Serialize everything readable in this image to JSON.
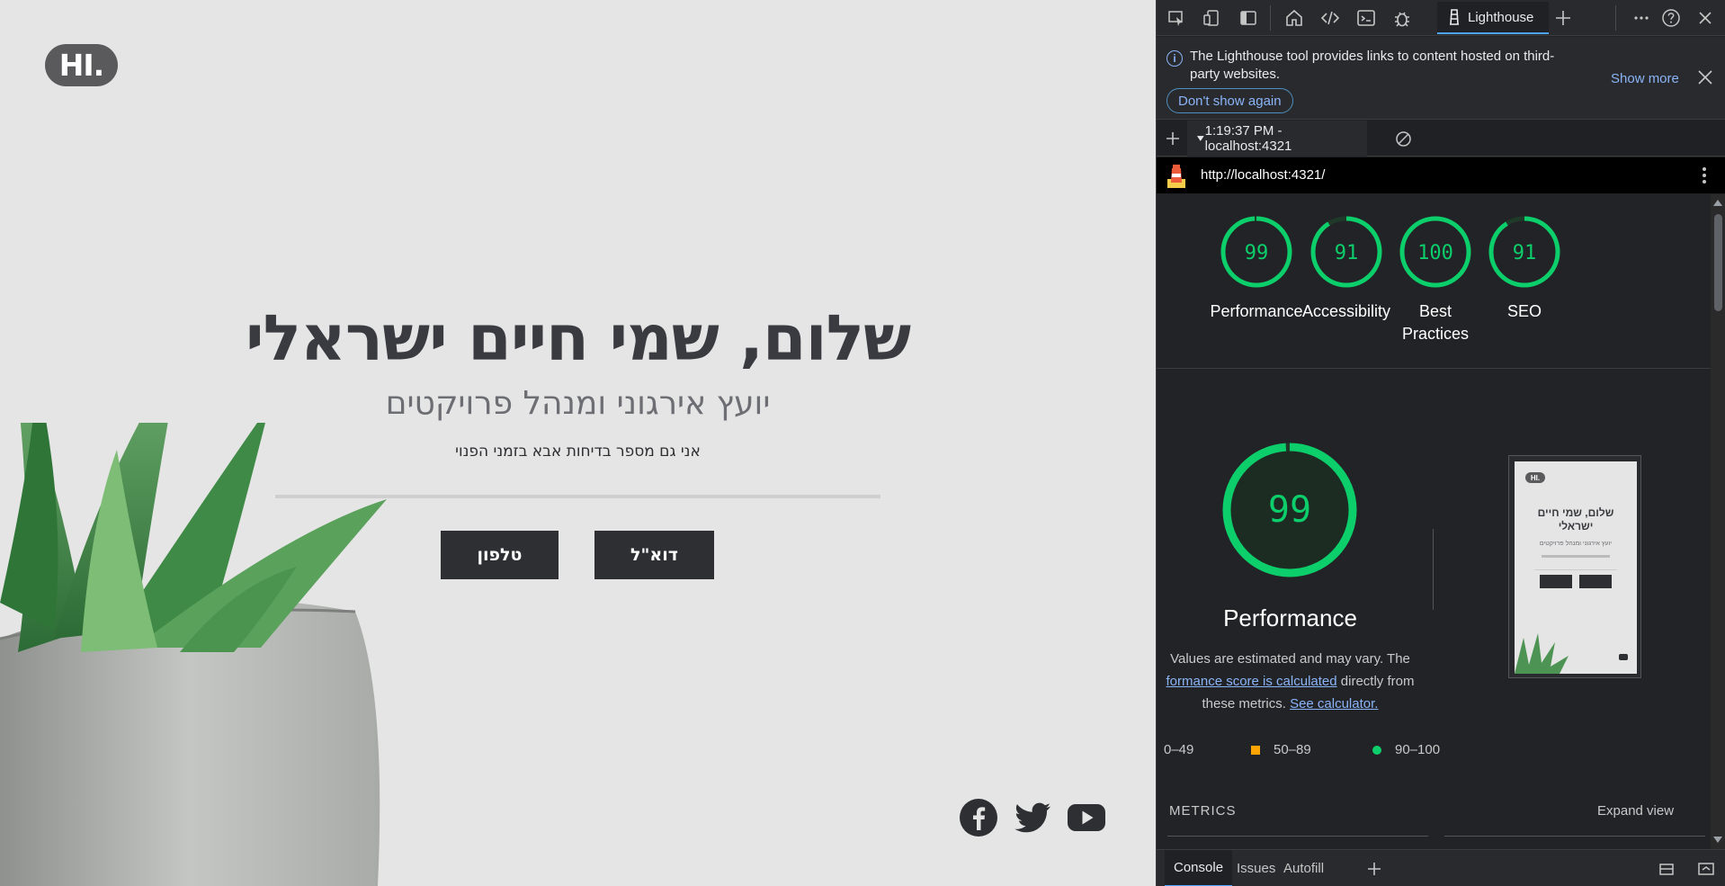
{
  "site": {
    "logo": "HI.",
    "title": "שלום, שמי חיים ישראלי",
    "subtitle": "יועץ אירגוני ומנהל פרויקטים",
    "tagline": "אני גם מספר בדיחות אבא בזמני הפנוי",
    "email_button": "דוא\"ל",
    "phone_button": "טלפון",
    "social": [
      "facebook-icon",
      "twitter-icon",
      "youtube-icon"
    ]
  },
  "devtools": {
    "tabs": {
      "active": "Lighthouse"
    },
    "infobar": {
      "message": "The Lighthouse tool provides links to content hosted on third-party websites.",
      "dont_show": "Don't show again",
      "show_more": "Show more"
    },
    "report_select": "1:19:37 PM - localhost:4321",
    "url": "http://localhost:4321/",
    "scores": [
      {
        "label": "Performance",
        "value": "99",
        "score": 99
      },
      {
        "label": "Accessibility",
        "value": "91",
        "score": 91
      },
      {
        "label": "Best Practices",
        "value": "100",
        "score": 100
      },
      {
        "label": "SEO",
        "value": "91",
        "score": 91
      }
    ],
    "performance": {
      "score": "99",
      "title": "Performance",
      "note_prefix": "Values are estimated and may vary. The",
      "note_link": "formance score is calculated",
      "note_mid": "directly from these metrics.",
      "note_link2": "See calculator."
    },
    "thumbnail": {
      "logo": "HI.",
      "title": "שלום, שמי חיים ישראלי",
      "subtitle": "יועץ אירגוני ומנהל פרויקטים"
    },
    "legend": [
      {
        "range": "0–49",
        "color": "#ff4e42"
      },
      {
        "range": "50–89",
        "color": "#ffa400"
      },
      {
        "range": "90–100",
        "color": "#0cce6b"
      }
    ],
    "metrics_label": "METRICS",
    "expand_view": "Expand view",
    "drawer_tabs": [
      "Console",
      "Issues",
      "Autofill"
    ]
  },
  "colors": {
    "pass": "#0cce6b",
    "link": "#8ab4f8",
    "site_bg": "#e5e5e5",
    "button": "#2e2f33"
  }
}
